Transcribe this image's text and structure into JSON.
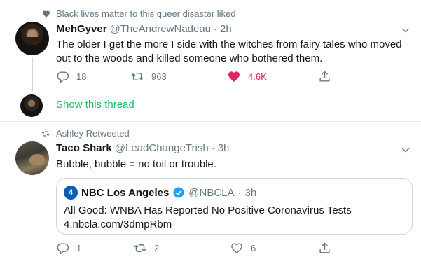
{
  "tweets": [
    {
      "context": "Black lives matter to this queer disaster liked",
      "context_icon": "heart-icon",
      "name": "MehGyver",
      "handle": "@TheAndrewNadeau",
      "time": "2h",
      "text": "The older I get the more I side with the witches from fairy tales who moved out to the woods and killed someone who bothered them.",
      "reply_count": "18",
      "retweet_count": "963",
      "like_count": "4.6K",
      "liked": true,
      "show_thread": "Show this thread"
    },
    {
      "context": "Ashley Retweeted",
      "context_icon": "retweet-icon",
      "name": "Taco Shark",
      "handle": "@LeadChangeTrish",
      "time": "3h",
      "text": "Bubble, bubble = no toil or trouble.",
      "quote": {
        "name": "NBC Los Angeles",
        "handle": "@NBCLA",
        "time": "3h",
        "verified": true,
        "text_line1": "All Good: WNBA Has Reported No Positive Coronavirus Tests",
        "text_line2": "4.nbcla.com/3dmpRbm"
      },
      "reply_count": "1",
      "retweet_count": "2",
      "like_count": "6"
    }
  ],
  "colors": {
    "like_active": "#e0245e",
    "muted": "#657786",
    "show_thread": "#17bf63",
    "verified": "#1da1f2",
    "border": "#e6ecf0"
  }
}
